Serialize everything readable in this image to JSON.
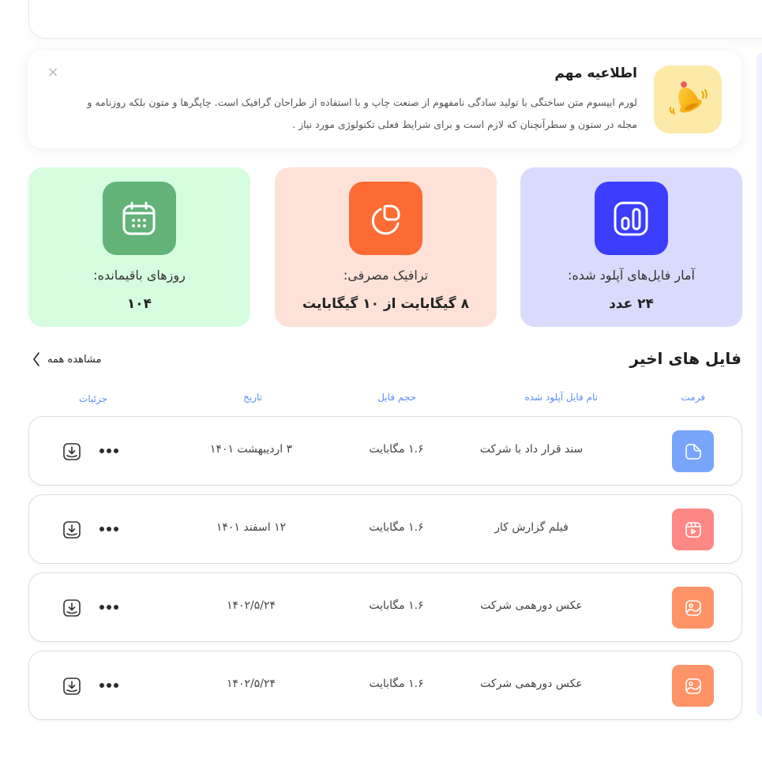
{
  "notice": {
    "title": "اطلاعیه مهم",
    "body": "لورم ایپسوم متن ساختگی با تولید سادگی نامفهوم از صنعت چاپ و با استفاده از طراحان گرافیک است. چاپگرها و متون بلکه روزنامه و مجله در ستون و سطرآنچنان که لازم است و برای شرایط فعلی تکنولوژی مورد نیاز .",
    "close_glyph": "×",
    "icon": "bell-icon"
  },
  "stats": [
    {
      "label": "آمار فایل‌های آپلود شده:",
      "value": "۲۴ عدد",
      "icon": "chart-icon",
      "color": "#3b3efc"
    },
    {
      "label": "ترافیک مصرفی:",
      "value": "۸ گیگابایت از ۱۰ گیگابایت",
      "icon": "pie-chart-icon",
      "color": "#fd6b35"
    },
    {
      "label": "روزهای باقیمانده:",
      "value": "۱۰۴",
      "icon": "calendar-icon",
      "color": "#63b378"
    }
  ],
  "recent": {
    "title": "فایل های اخیر",
    "view_all": "مشاهده همه",
    "columns": {
      "format": "فرمت",
      "name": "نام فایل آپلود شده",
      "size": "حجم فایل",
      "date": "تاریخ",
      "details": "جزئیات"
    },
    "rows": [
      {
        "format_icon": "document-icon",
        "format_color": "#78a5fb",
        "name": "سند قرار داد با شرکت",
        "size": "۱.۶ مگابایت",
        "date": "۳ اردیبهشت ۱۴۰۱"
      },
      {
        "format_icon": "video-icon",
        "format_color": "#fe8886",
        "name": "فیلم گزارش کار",
        "size": "۱.۶ مگابایت",
        "date": "۱۲ اسفند ۱۴۰۱"
      },
      {
        "format_icon": "image-icon",
        "format_color": "#fe9368",
        "name": "عکس دورهمی شرکت",
        "size": "۱.۶ مگابایت",
        "date": "۱۴۰۲/۵/۲۴"
      },
      {
        "format_icon": "image-icon",
        "format_color": "#fe9368",
        "name": "عکس دورهمی شرکت",
        "size": "۱.۶ مگابایت",
        "date": "۱۴۰۲/۵/۲۴"
      }
    ]
  }
}
